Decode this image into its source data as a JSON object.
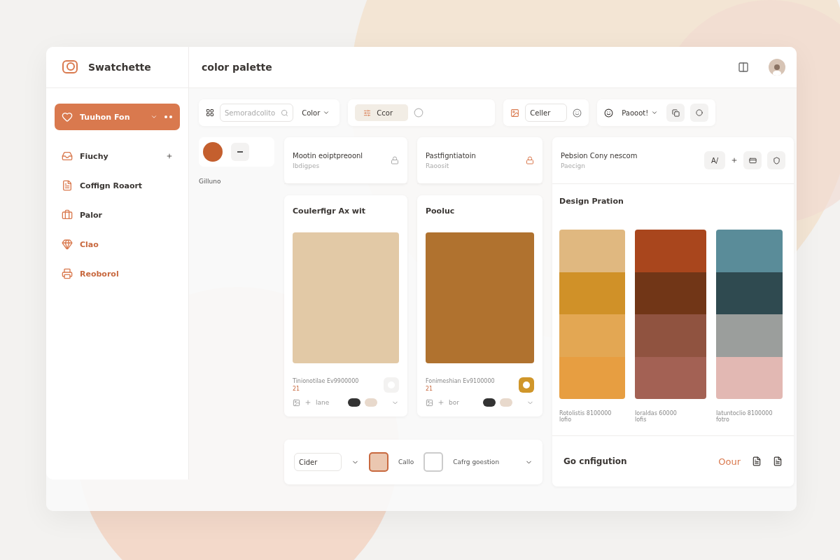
{
  "app": {
    "name": "Swatchette"
  },
  "header": {
    "title": "color palette"
  },
  "sidebar": {
    "items": [
      {
        "label": "Tuuhon Fon",
        "selected": true,
        "color": "#ffffff"
      },
      {
        "label": "Fiuchy",
        "selected": false,
        "color": "#3a3633"
      },
      {
        "label": "Coffign Roaort",
        "selected": false,
        "color": "#3a3633"
      },
      {
        "label": "Palor",
        "selected": false,
        "color": "#3a3633"
      },
      {
        "label": "Clao",
        "selected": false,
        "color": "#c8693f"
      },
      {
        "label": "Reoborol",
        "selected": false,
        "color": "#c8693f"
      }
    ]
  },
  "toolbar": {
    "search": {
      "placeholder": "Semoradcolito"
    },
    "color_dropdown": "Color",
    "chip": "Ccor",
    "field": "Celler",
    "preset_dropdown": "Paooot!"
  },
  "swatch_tile": {
    "label": "Gilluno"
  },
  "card_headers": [
    {
      "title": "Mootin eoiptpreoonl",
      "subtitle": "Ibdigpes"
    },
    {
      "title": "Pastfigntiatoin",
      "subtitle": "Raoosit"
    },
    {
      "title": "Pebsion Cony nescom",
      "subtitle": "Paecign",
      "tool": "A/"
    }
  ],
  "swatch_cards": [
    {
      "title": "Coulerfigr Ax wit",
      "color": "#e2c9a6",
      "caption": "Tinionotilae Ev9900000",
      "code": "21",
      "on": false,
      "footer": "lane"
    },
    {
      "title": "Pooluc",
      "color": "#b0722f",
      "caption": "Fonimeshian Ev9100000",
      "code": "21",
      "on": true,
      "footer": "bor"
    }
  ],
  "palette": {
    "title": "Design Pration",
    "columns": [
      {
        "shades": [
          {
            "color": "#e0b880"
          },
          {
            "color": "#d09128"
          },
          {
            "color": "#e3a753"
          },
          {
            "color": "#e79e41"
          }
        ],
        "caption": "Rotolistis 8100000",
        "sub": "lofio"
      },
      {
        "shades": [
          {
            "color": "#a9461d"
          },
          {
            "color": "#713617"
          },
          {
            "color": "#905340"
          },
          {
            "color": "#a36154"
          }
        ],
        "caption": "Ioraldas 60000",
        "sub": "lofis"
      },
      {
        "shades": [
          {
            "color": "#5a8c99"
          },
          {
            "color": "#2f4a50"
          },
          {
            "color": "#9b9e9c"
          },
          {
            "color": "#e2b8b3"
          }
        ],
        "caption": "Iatuntoclio 8100000",
        "sub": "fotro"
      }
    ]
  },
  "bottom_bar": {
    "select": "Cider",
    "options": [
      {
        "label": "Callo",
        "checked": true
      },
      {
        "label": "Cafrg goestion",
        "checked": false
      }
    ]
  },
  "config": {
    "title": "Go cnfigution",
    "link": "Oour"
  }
}
